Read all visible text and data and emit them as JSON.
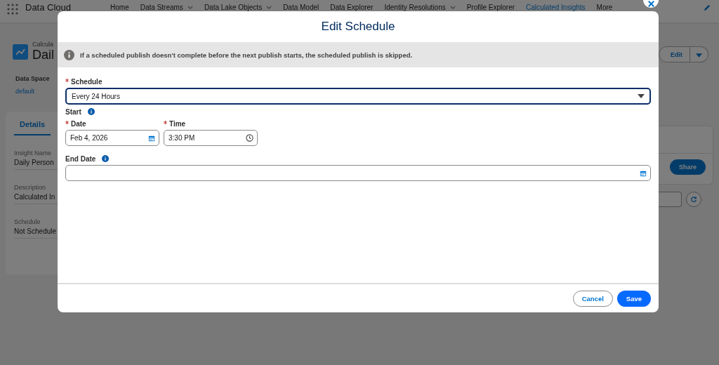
{
  "app": {
    "name": "Data Cloud"
  },
  "nav": [
    {
      "label": "Home",
      "selected": false,
      "has_menu": false
    },
    {
      "label": "Data Streams",
      "selected": false,
      "has_menu": true
    },
    {
      "label": "Data Lake Objects",
      "selected": false,
      "has_menu": true
    },
    {
      "label": "Data Model",
      "selected": false,
      "has_menu": false
    },
    {
      "label": "Data Explorer",
      "selected": false,
      "has_menu": false
    },
    {
      "label": "Identity Resolutions",
      "selected": false,
      "has_menu": true
    },
    {
      "label": "Profile Explorer",
      "selected": false,
      "has_menu": false
    },
    {
      "label": "Calculated Insights",
      "selected": true,
      "has_menu": false
    },
    {
      "label": "More",
      "selected": false,
      "has_menu": false
    }
  ],
  "record": {
    "type_label": "Calcula",
    "title": "Dail",
    "data_space": {
      "label": "Data Space",
      "value": "default"
    },
    "tabs": [
      {
        "label": "Details",
        "selected": true
      }
    ],
    "details": [
      {
        "label": "Insight Name",
        "value": "Daily Person"
      },
      {
        "label": "Description",
        "value": "Calculated In"
      },
      {
        "label": "Schedule",
        "value": "Not Schedule"
      }
    ]
  },
  "actions": {
    "edit": "Edit",
    "share": "Share"
  },
  "modal": {
    "title": "Edit Schedule",
    "notice": "If a scheduled publish doesn't complete before the next publish starts, the scheduled publish is skipped.",
    "schedule": {
      "label": "Schedule",
      "required": true,
      "value": "Every 24 Hours"
    },
    "start_label": "Start",
    "date": {
      "label": "Date",
      "required": true,
      "value": "Feb 4, 2026"
    },
    "time": {
      "label": "Time",
      "required": true,
      "value": "3:30 PM"
    },
    "end_date": {
      "label": "End Date",
      "required": false
    },
    "buttons": {
      "cancel": "Cancel",
      "save": "Save"
    }
  }
}
